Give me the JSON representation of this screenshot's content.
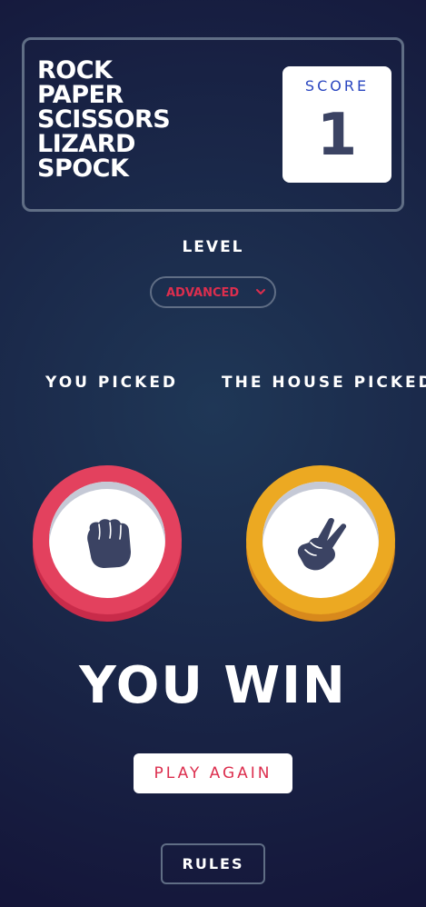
{
  "header": {
    "title_lines": [
      "ROCK",
      "PAPER",
      "SCISSORS",
      "LIZARD",
      "SPOCK"
    ],
    "score_label": "SCORE",
    "score_value": "1"
  },
  "level": {
    "label": "LEVEL",
    "selected": "ADVANCED"
  },
  "game": {
    "you_label": "YOU PICKED",
    "house_label": "THE HOUSE PICKED",
    "you_pick": {
      "name": "rock",
      "icon": "rock-fist-icon",
      "color": "#e3415e"
    },
    "house_pick": {
      "name": "scissors",
      "icon": "scissors-hand-icon",
      "color": "#eca922"
    },
    "result": "YOU WIN",
    "play_again_label": "PLAY AGAIN"
  },
  "footer": {
    "rules_label": "RULES"
  },
  "colors": {
    "background_start": "#1f3756",
    "background_end": "#141539",
    "header_outline": "#606e85",
    "score_text": "#3b4363",
    "score_label": "#2a46c0",
    "accent_red": "#dc2e4e"
  }
}
